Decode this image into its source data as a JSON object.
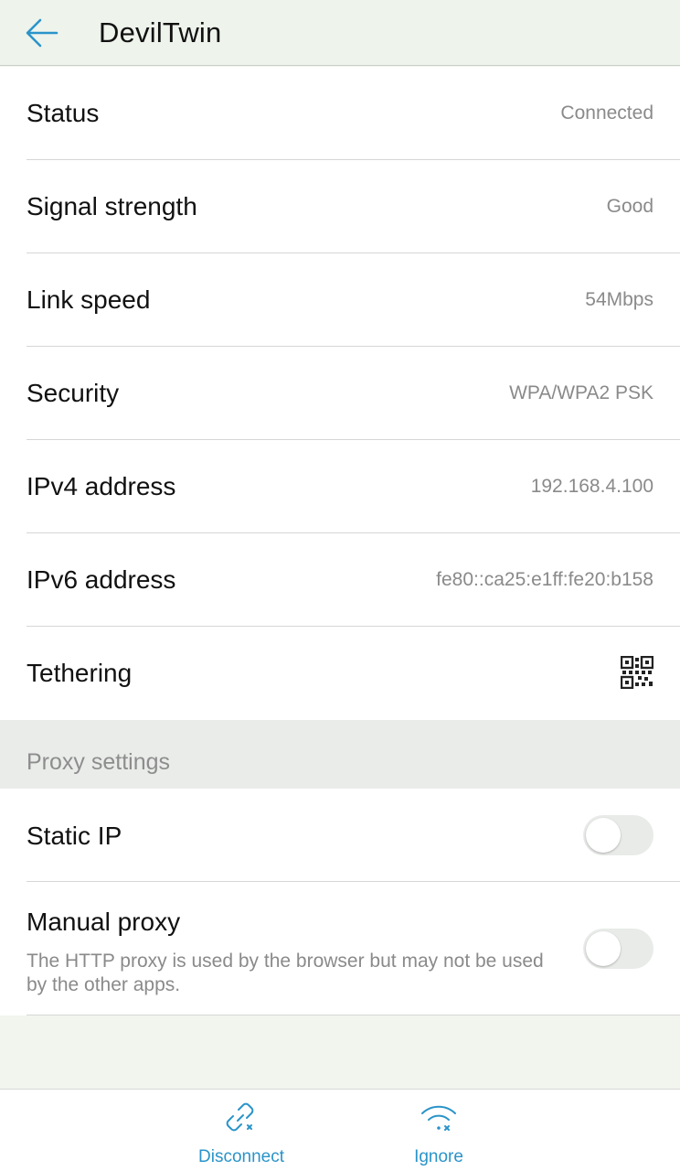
{
  "header": {
    "title": "DevilTwin",
    "back_icon": "arrow-left-icon"
  },
  "details": [
    {
      "label": "Status",
      "value": "Connected"
    },
    {
      "label": "Signal strength",
      "value": "Good"
    },
    {
      "label": "Link speed",
      "value": "54Mbps"
    },
    {
      "label": "Security",
      "value": "WPA/WPA2 PSK"
    },
    {
      "label": "IPv4 address",
      "value": "192.168.4.100"
    },
    {
      "label": "IPv6 address",
      "value": "fe80::ca25:e1ff:fe20:b158"
    },
    {
      "label": "Tethering",
      "icon": "qr-code-icon"
    }
  ],
  "proxy": {
    "section_title": "Proxy settings",
    "static_ip": {
      "label": "Static IP",
      "enabled": false
    },
    "manual_proxy": {
      "label": "Manual proxy",
      "description": "The HTTP proxy is used by the browser but may not be used by the other apps.",
      "enabled": false
    }
  },
  "bottom_bar": {
    "disconnect": {
      "label": "Disconnect",
      "icon": "broken-link-icon"
    },
    "ignore": {
      "label": "Ignore",
      "icon": "wifi-forget-icon"
    }
  },
  "colors": {
    "accent": "#2a94c9",
    "secondary_text": "#8a8a8a",
    "background": "#f1f5ee"
  }
}
